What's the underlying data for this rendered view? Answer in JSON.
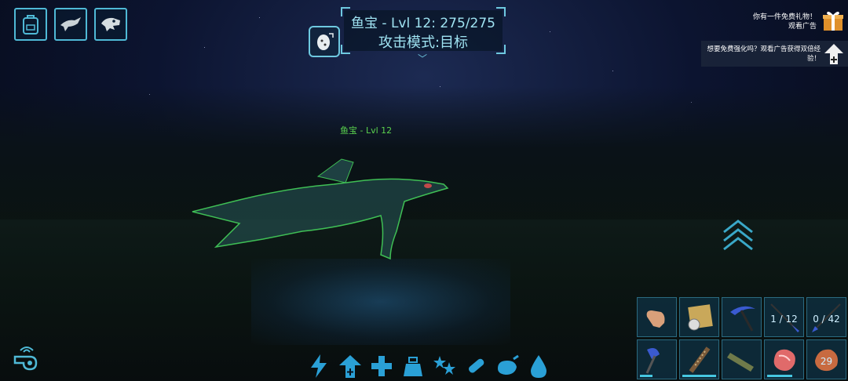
{
  "target": {
    "title": "鱼宝 - Lvl 12: 275/275",
    "mode": "攻击模式:目标"
  },
  "creature": {
    "name": "鱼宝 - Lvl 12"
  },
  "ads": {
    "gift_text_1": "你有一件免费礼物！",
    "gift_text_2": "观看广告",
    "boost_text": "想要免费强化吗？观看广告获得双倍经验！"
  },
  "top_icons": [
    "backpack-icon",
    "tame-creature-icon",
    "dino-skull-icon"
  ],
  "status_icons": [
    "health-lightning-icon",
    "level-up-icon",
    "health-plus-icon",
    "weight-icon",
    "xp-stars-icon",
    "oxygen-bandage-icon",
    "food-icon",
    "water-drop-icon"
  ],
  "hotbar": {
    "slots": [
      {
        "item": "hand-icon",
        "count": ""
      },
      {
        "item": "map-compass-icon",
        "count": ""
      },
      {
        "item": "pickaxe-icon",
        "count": ""
      },
      {
        "item": "spear-icon",
        "count": "1 / 12"
      },
      {
        "item": "bow-icon",
        "count": "0 / 42"
      },
      {
        "item": "hatchet-icon",
        "count": ""
      },
      {
        "item": "torch-icon",
        "count": ""
      },
      {
        "item": "spyglass-icon",
        "count": ""
      },
      {
        "item": "raw-meat-icon",
        "count": ""
      },
      {
        "item": "cooked-meat-icon",
        "count": "29"
      }
    ]
  },
  "colors": {
    "accent": "#4fb9d6",
    "creature_name": "#5ad14d",
    "panel_text": "#9fe3f2"
  }
}
